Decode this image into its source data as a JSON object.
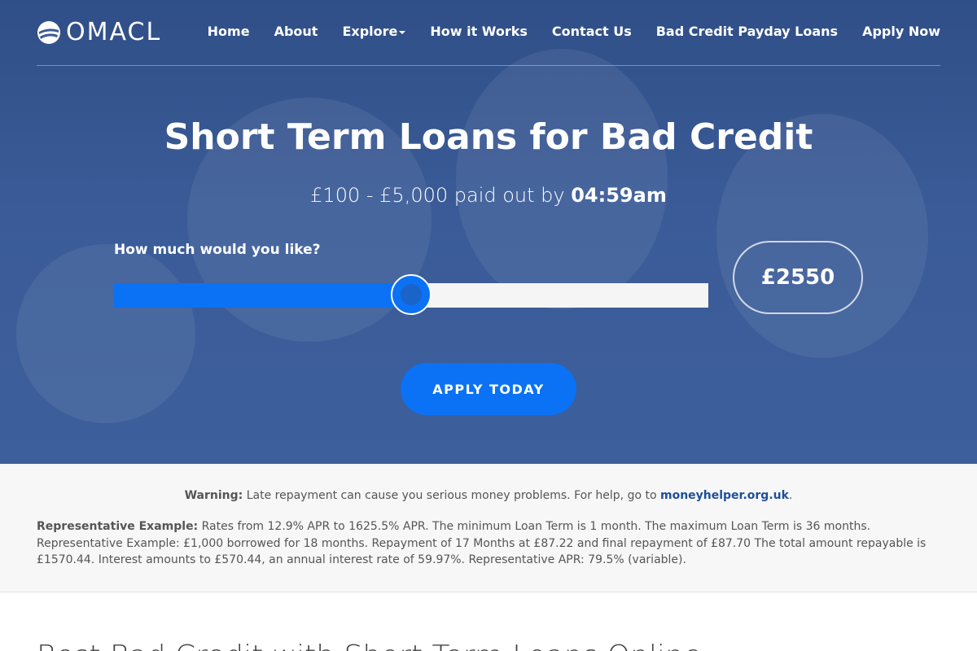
{
  "nav": {
    "logo_text": "OMACL",
    "items": [
      {
        "label": "Home"
      },
      {
        "label": "About"
      },
      {
        "label": "Explore"
      },
      {
        "label": "How it Works"
      },
      {
        "label": "Contact Us"
      },
      {
        "label": "Bad Credit Payday Loans"
      },
      {
        "label": "Apply Now"
      }
    ]
  },
  "hero": {
    "title": "Short Term Loans for Bad Credit",
    "subtitle_prefix": "£100 - £5,000 paid out by ",
    "subtitle_time": "04:59am",
    "slider_label": "How much would you like?",
    "slider_min": 100,
    "slider_max": 5000,
    "slider_value": 2550,
    "amount_display": "£2550",
    "apply_button": "APPLY TODAY"
  },
  "info": {
    "warning_label": "Warning:",
    "warning_text": " Late repayment can cause you serious money problems. For help, go to ",
    "warning_link": "moneyhelper.org.uk",
    "warning_end": ".",
    "rep_label": "Representative Example:",
    "rep_text": " Rates from 12.9% APR to 1625.5% APR. The minimum Loan Term is 1 month. The maximum Loan Term is 36 months. Representative Example: £1,000 borrowed for 18 months. Repayment of 17 Months at £87.22 and final repayment of £87.70 The total amount repayable is £1570.44. Interest amounts to £570.44, an annual interest rate of 59.97%. Representative APR: 79.5% (variable)."
  },
  "bottom": {
    "heading": "Best Bad Credit with Short Term Loans Online"
  },
  "colors": {
    "accent": "#0b72f5",
    "hero_bg": "#3a5b97",
    "link": "#1d4f99"
  }
}
